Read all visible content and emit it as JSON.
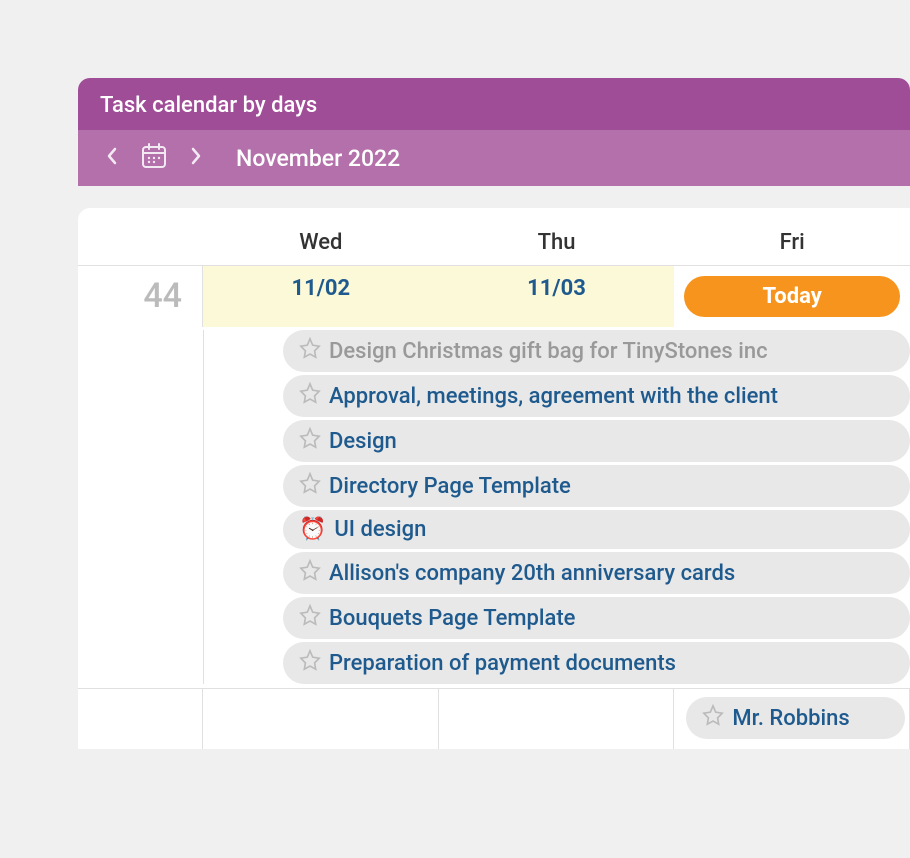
{
  "header": {
    "title": "Task calendar by days"
  },
  "nav": {
    "month": "November 2022"
  },
  "dayHeaders": [
    "Wed",
    "Thu",
    "Fri"
  ],
  "weekNumber": "44",
  "dates": {
    "wed": "11/02",
    "thu": "11/03",
    "today": "Today"
  },
  "tasks": [
    {
      "title": "Design Christmas gift bag for TinyStones inc",
      "completed": true,
      "hasAlarm": false
    },
    {
      "title": "Approval, meetings, agreement with the client",
      "completed": false,
      "hasAlarm": false
    },
    {
      "title": "Design",
      "completed": false,
      "hasAlarm": false
    },
    {
      "title": "Directory Page Template",
      "completed": false,
      "hasAlarm": false
    },
    {
      "title": "UI design",
      "completed": false,
      "hasAlarm": true
    },
    {
      "title": "Allison's company 20th anniversary cards",
      "completed": false,
      "hasAlarm": false
    },
    {
      "title": "Bouquets Page Template",
      "completed": false,
      "hasAlarm": false
    },
    {
      "title": "Preparation of payment documents",
      "completed": false,
      "hasAlarm": false
    }
  ],
  "bottomTask": {
    "title": "Mr. Robbins"
  }
}
